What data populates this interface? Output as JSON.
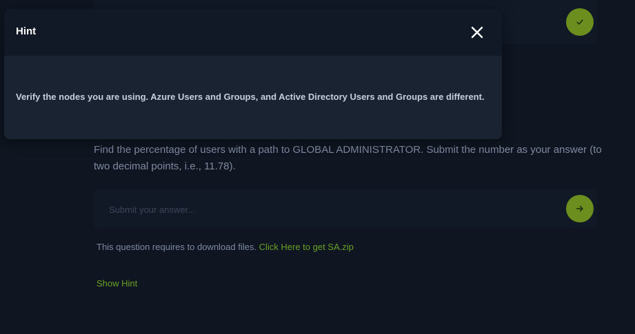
{
  "modal": {
    "title": "Hint",
    "body": "Verify the nodes you are using. Azure Users and Groups, and Active Directory Users and Groups are different."
  },
  "question": {
    "text": "Find the percentage of users with a path to GLOBAL ADMINISTRATOR. Submit the number as your answer (to two decimal points, i.e., 11.78).",
    "answer_value": "",
    "answer_placeholder": "Submit your answer..."
  },
  "download": {
    "prefix": "This question requires to download files.",
    "link_text": "Click Here to get SA.zip"
  },
  "show_hint_label": "Show Hint",
  "icons": {
    "close": "close-icon",
    "check": "check-icon",
    "submit": "arrow-right-icon"
  },
  "colors": {
    "background": "#0f1621",
    "panel": "#111927",
    "modal_body": "#1a2332",
    "accent_green": "#6b8e1f",
    "link_green": "#6aa024"
  }
}
